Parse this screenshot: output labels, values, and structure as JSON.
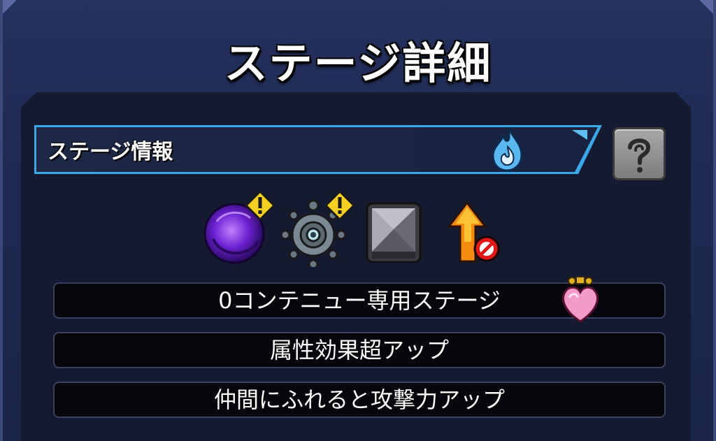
{
  "title": "ステージ詳細",
  "info_bar": {
    "label": "ステージ情報",
    "element_icon": "water-element-icon",
    "help_icon": "question-icon"
  },
  "gimmicks": [
    {
      "icon": "black-hole-icon",
      "warning": true
    },
    {
      "icon": "gravity-barrier-icon",
      "warning": true
    },
    {
      "icon": "block-icon",
      "warning": false
    },
    {
      "icon": "speed-up-disabled-icon",
      "warning": false
    }
  ],
  "rules": [
    {
      "text": "0コンテニュー専用ステージ",
      "icon": "heart-potion-icon"
    },
    {
      "text": "属性効果超アップ"
    },
    {
      "text": "仲間にふれると攻撃力アップ"
    }
  ],
  "colors": {
    "accent": "#3aa8e8",
    "warning": "#f5d020",
    "frame": "#1e2a52"
  }
}
